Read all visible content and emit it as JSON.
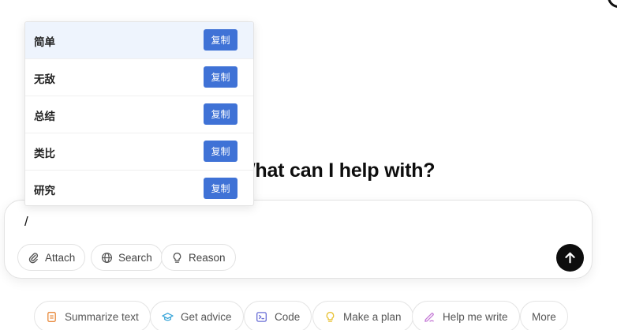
{
  "heading": "What can I help with?",
  "composer": {
    "input_value": "/",
    "tools": [
      {
        "label": "Attach",
        "icon": "paperclip-icon"
      },
      {
        "label": "Search",
        "icon": "globe-icon"
      },
      {
        "label": "Reason",
        "icon": "lightbulb-icon"
      }
    ],
    "send_icon": "arrow-up-icon"
  },
  "suggestions": [
    {
      "label": "Summarize text",
      "icon": "document-icon",
      "color": "#e8893b"
    },
    {
      "label": "Get advice",
      "icon": "graduation-cap-icon",
      "color": "#3aa6d9"
    },
    {
      "label": "Code",
      "icon": "code-icon",
      "color": "#6a6fd6"
    },
    {
      "label": "Make a plan",
      "icon": "lightbulb-icon",
      "color": "#e8c131"
    },
    {
      "label": "Help me write",
      "icon": "pen-icon",
      "color": "#c57ad6"
    },
    {
      "label": "More",
      "icon": "",
      "color": ""
    }
  ],
  "dropdown": {
    "copy_label": "复制",
    "items": [
      {
        "label": "简单",
        "highlighted": true
      },
      {
        "label": "无敌",
        "highlighted": false
      },
      {
        "label": "总结",
        "highlighted": false
      },
      {
        "label": "类比",
        "highlighted": false
      },
      {
        "label": "研究",
        "highlighted": false
      }
    ]
  },
  "colors": {
    "accent_blue": "#3f72d6",
    "send_button": "#0d0d0d",
    "highlight_row": "#eef4fd"
  }
}
